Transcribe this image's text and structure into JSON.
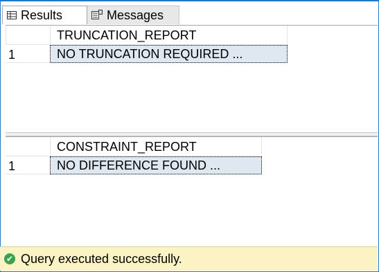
{
  "tabs": [
    {
      "label": "Results",
      "icon": "grid-icon"
    },
    {
      "label": "Messages",
      "icon": "messages-icon"
    }
  ],
  "results": [
    {
      "column_header": "TRUNCATION_REPORT",
      "rows": [
        {
          "num": "1",
          "value": "NO TRUNCATION REQUIRED ..."
        }
      ]
    },
    {
      "column_header": "CONSTRAINT_REPORT",
      "rows": [
        {
          "num": "1",
          "value": "NO DIFFERENCE FOUND ..."
        }
      ]
    }
  ],
  "status": {
    "text": "Query executed successfully.",
    "icon": "check-circle-icon",
    "color": "#3aa14d",
    "background": "#fbf3c4"
  }
}
